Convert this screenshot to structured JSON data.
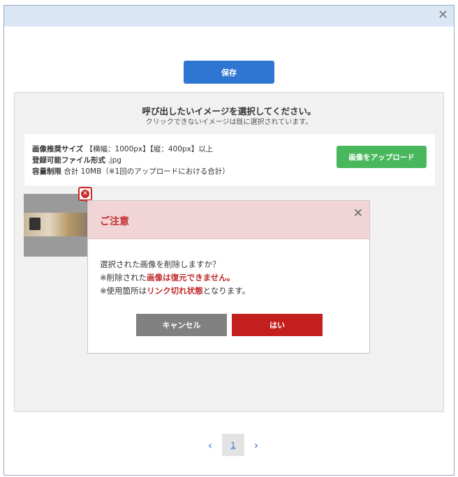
{
  "window": {
    "close_glyph": "✕"
  },
  "toolbar": {
    "save_label": "保存"
  },
  "panel": {
    "title": "呼び出したいイメージを選択してください。",
    "subtitle": "クリックできないイメージは既に選択されています。",
    "info": {
      "size_label": "画像推奨サイズ",
      "size_value": "【横幅：1000px】【縦：400px】以上",
      "format_label": "登録可能ファイル形式",
      "format_value": ".jpg",
      "capacity_label": "容量制限",
      "capacity_value": "合計 10MB（※1回のアップロードにおける合計）"
    },
    "upload_label": "画像をアップロード"
  },
  "dialog": {
    "title": "ご注意",
    "close_glyph": "✕",
    "line1": "選択された画像を削除しますか？",
    "line2_pre": "※削除された",
    "line2_red": "画像は復元できません。",
    "line3_pre": "※使用箇所は",
    "line3_red": "リンク切れ状態",
    "line3_post": "となります。",
    "cancel_label": "キャンセル",
    "yes_label": "はい"
  },
  "pagination": {
    "prev": "‹",
    "current": "1",
    "next": "›"
  },
  "colors": {
    "accent": "#2f76d2",
    "upload": "#49b75c",
    "danger": "#c41f1f",
    "dialog_header": "#f0d4d6"
  },
  "icons": {
    "delete": "delete-circle-icon",
    "arrow": "red-arrow-icon",
    "close": "close-icon"
  }
}
